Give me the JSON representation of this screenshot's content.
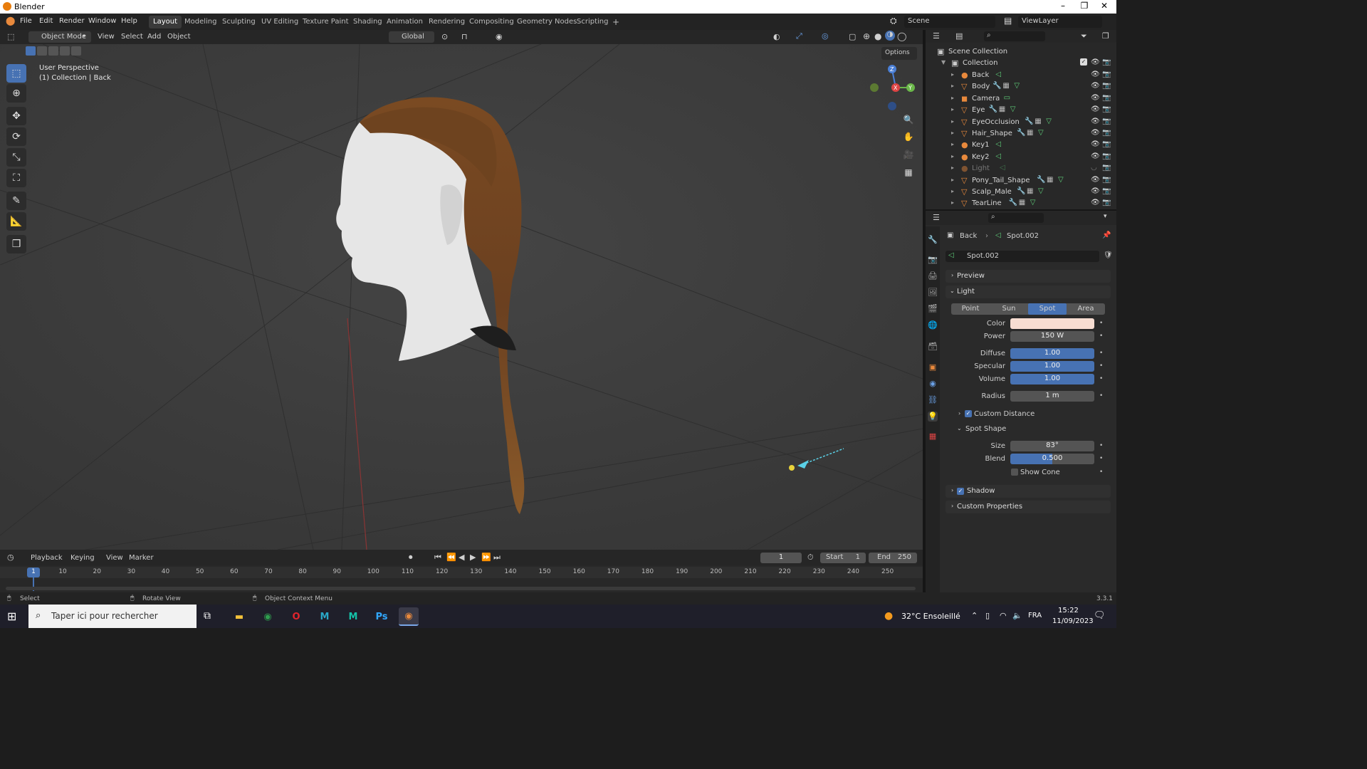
{
  "window": {
    "title": "Blender"
  },
  "menu": {
    "items": [
      "File",
      "Edit",
      "Render",
      "Window",
      "Help"
    ]
  },
  "workspaces": [
    "Layout",
    "Modeling",
    "Sculpting",
    "UV Editing",
    "Texture Paint",
    "Shading",
    "Animation",
    "Rendering",
    "Compositing",
    "Geometry Nodes",
    "Scripting"
  ],
  "header3d": {
    "mode": "Object Mode",
    "menus": [
      "View",
      "Select",
      "Add",
      "Object"
    ],
    "orientation": "Global",
    "options": "Options"
  },
  "scene": {
    "scene_name": "Scene",
    "view_layer": "ViewLayer"
  },
  "viewport": {
    "overlay_line1": "User Perspective",
    "overlay_line2": "(1) Collection | Back",
    "gizmo_axes": {
      "x": "X",
      "y": "Y",
      "z": "Z"
    }
  },
  "outliner": {
    "root": "Scene Collection",
    "collection": "Collection",
    "items": [
      {
        "name": "Back",
        "type": "light"
      },
      {
        "name": "Body",
        "type": "mesh"
      },
      {
        "name": "Camera",
        "type": "camera"
      },
      {
        "name": "Eye",
        "type": "mesh"
      },
      {
        "name": "EyeOcclusion",
        "type": "mesh"
      },
      {
        "name": "Hair_Shape",
        "type": "mesh"
      },
      {
        "name": "Key1",
        "type": "light"
      },
      {
        "name": "Key2",
        "type": "light"
      },
      {
        "name": "Light",
        "type": "light"
      },
      {
        "name": "Pony_Tail_Shape",
        "type": "mesh"
      },
      {
        "name": "Scalp_Male",
        "type": "mesh"
      },
      {
        "name": "TearLine",
        "type": "mesh"
      }
    ]
  },
  "properties": {
    "breadcrumb_object": "Back",
    "breadcrumb_data": "Spot.002",
    "datablock": "Spot.002",
    "preview": "Preview",
    "light_section": "Light",
    "light_types": [
      "Point",
      "Sun",
      "Spot",
      "Area"
    ],
    "active_type": "Spot",
    "color_label": "Color",
    "color_value": "#f7ddd2",
    "power_label": "Power",
    "power": "150 W",
    "diffuse_label": "Diffuse",
    "diffuse": "1.00",
    "specular_label": "Specular",
    "specular": "1.00",
    "volume_label": "Volume",
    "volume": "1.00",
    "radius_label": "Radius",
    "radius": "1 m",
    "custom_distance": "Custom Distance",
    "spot_shape": "Spot Shape",
    "size_label": "Size",
    "size": "83°",
    "blend_label": "Blend",
    "blend": "0.500",
    "show_cone": "Show Cone",
    "shadow": "Shadow",
    "custom_properties": "Custom Properties"
  },
  "timeline": {
    "menus": [
      "Playback",
      "Keying",
      "View",
      "Marker"
    ],
    "current_frame": "1",
    "start_label": "Start",
    "start": "1",
    "end_label": "End",
    "end": "250",
    "ruler": [
      "1",
      "10",
      "20",
      "30",
      "40",
      "50",
      "60",
      "70",
      "80",
      "90",
      "100",
      "110",
      "120",
      "130",
      "140",
      "150",
      "160",
      "170",
      "180",
      "190",
      "200",
      "210",
      "220",
      "230",
      "240",
      "250"
    ]
  },
  "status": {
    "select": "Select",
    "rotate": "Rotate View",
    "context": "Object Context Menu",
    "version": "3.3.1"
  },
  "taskbar": {
    "search_placeholder": "Taper ici pour rechercher",
    "weather": "32°C Ensoleillé",
    "lang": "FRA",
    "time": "15:22",
    "date": "11/09/2023"
  },
  "colors": {
    "accent": "#4772b3",
    "orange": "#e8893c",
    "viewport": "#3c3c3c"
  }
}
